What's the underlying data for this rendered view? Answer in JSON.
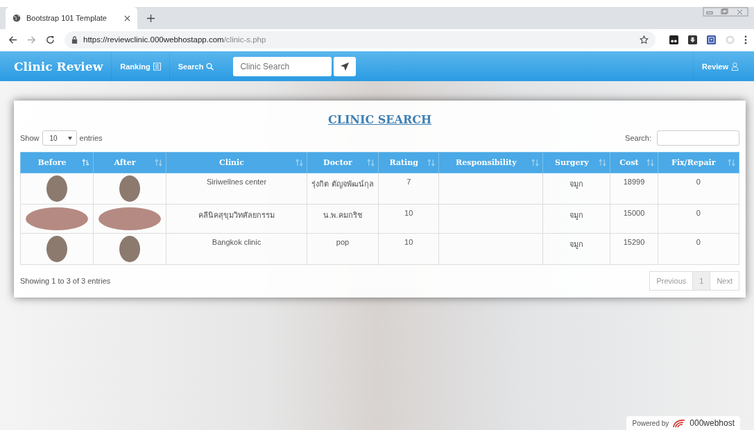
{
  "browser": {
    "tab_title": "Bootstrap 101 Template",
    "url_host": "https://reviewclinic.000webhostapp.com",
    "url_path": "/clinic-s.php"
  },
  "navbar": {
    "brand": "Clinic Review",
    "links": [
      {
        "label": "Ranking"
      },
      {
        "label": "Search"
      }
    ],
    "search": {
      "placeholder": "Clinic Search"
    },
    "right_link": {
      "label": "Review"
    }
  },
  "card": {
    "title": "CLINIC SEARCH",
    "length_label_before": "Show",
    "length_value": "10",
    "length_label_after": "entries",
    "search_label": "Search:",
    "columns": [
      {
        "label": "Before",
        "sorted": true
      },
      {
        "label": "After",
        "sorted": false
      },
      {
        "label": "Clinic",
        "sorted": false
      },
      {
        "label": "Doctor",
        "sorted": false
      },
      {
        "label": "Rating",
        "sorted": false
      },
      {
        "label": "Responsibility",
        "sorted": false
      },
      {
        "label": "Surgery",
        "sorted": false
      },
      {
        "label": "Cost",
        "sorted": false
      },
      {
        "label": "Fix/Repair",
        "sorted": false
      }
    ],
    "rows": [
      {
        "clinic": "Siriwellnes center",
        "doctor": "รุ่งกิต ตัญจพัฒน์กุล",
        "rating": "7",
        "surgery": "จมูก",
        "cost": "18999",
        "fix_repair": "0"
      },
      {
        "clinic": "คลีนิคสุขุมวิทศัลยกรรม",
        "doctor": "น.พ.คมกริช",
        "rating": "10",
        "surgery": "จมูก",
        "cost": "15000",
        "fix_repair": "0"
      },
      {
        "clinic": "Bangkok clinic",
        "doctor": "pop",
        "rating": "10",
        "surgery": "จมูก",
        "cost": "15290",
        "fix_repair": "0"
      }
    ],
    "info": "Showing 1 to 3 of 3 entries",
    "pagination": [
      {
        "label": "Previous",
        "selected": false
      },
      {
        "label": "1",
        "selected": true
      },
      {
        "label": "Next",
        "selected": false
      }
    ]
  },
  "footer_badge": {
    "prefix": "Powered by",
    "brand": "000webhost"
  }
}
